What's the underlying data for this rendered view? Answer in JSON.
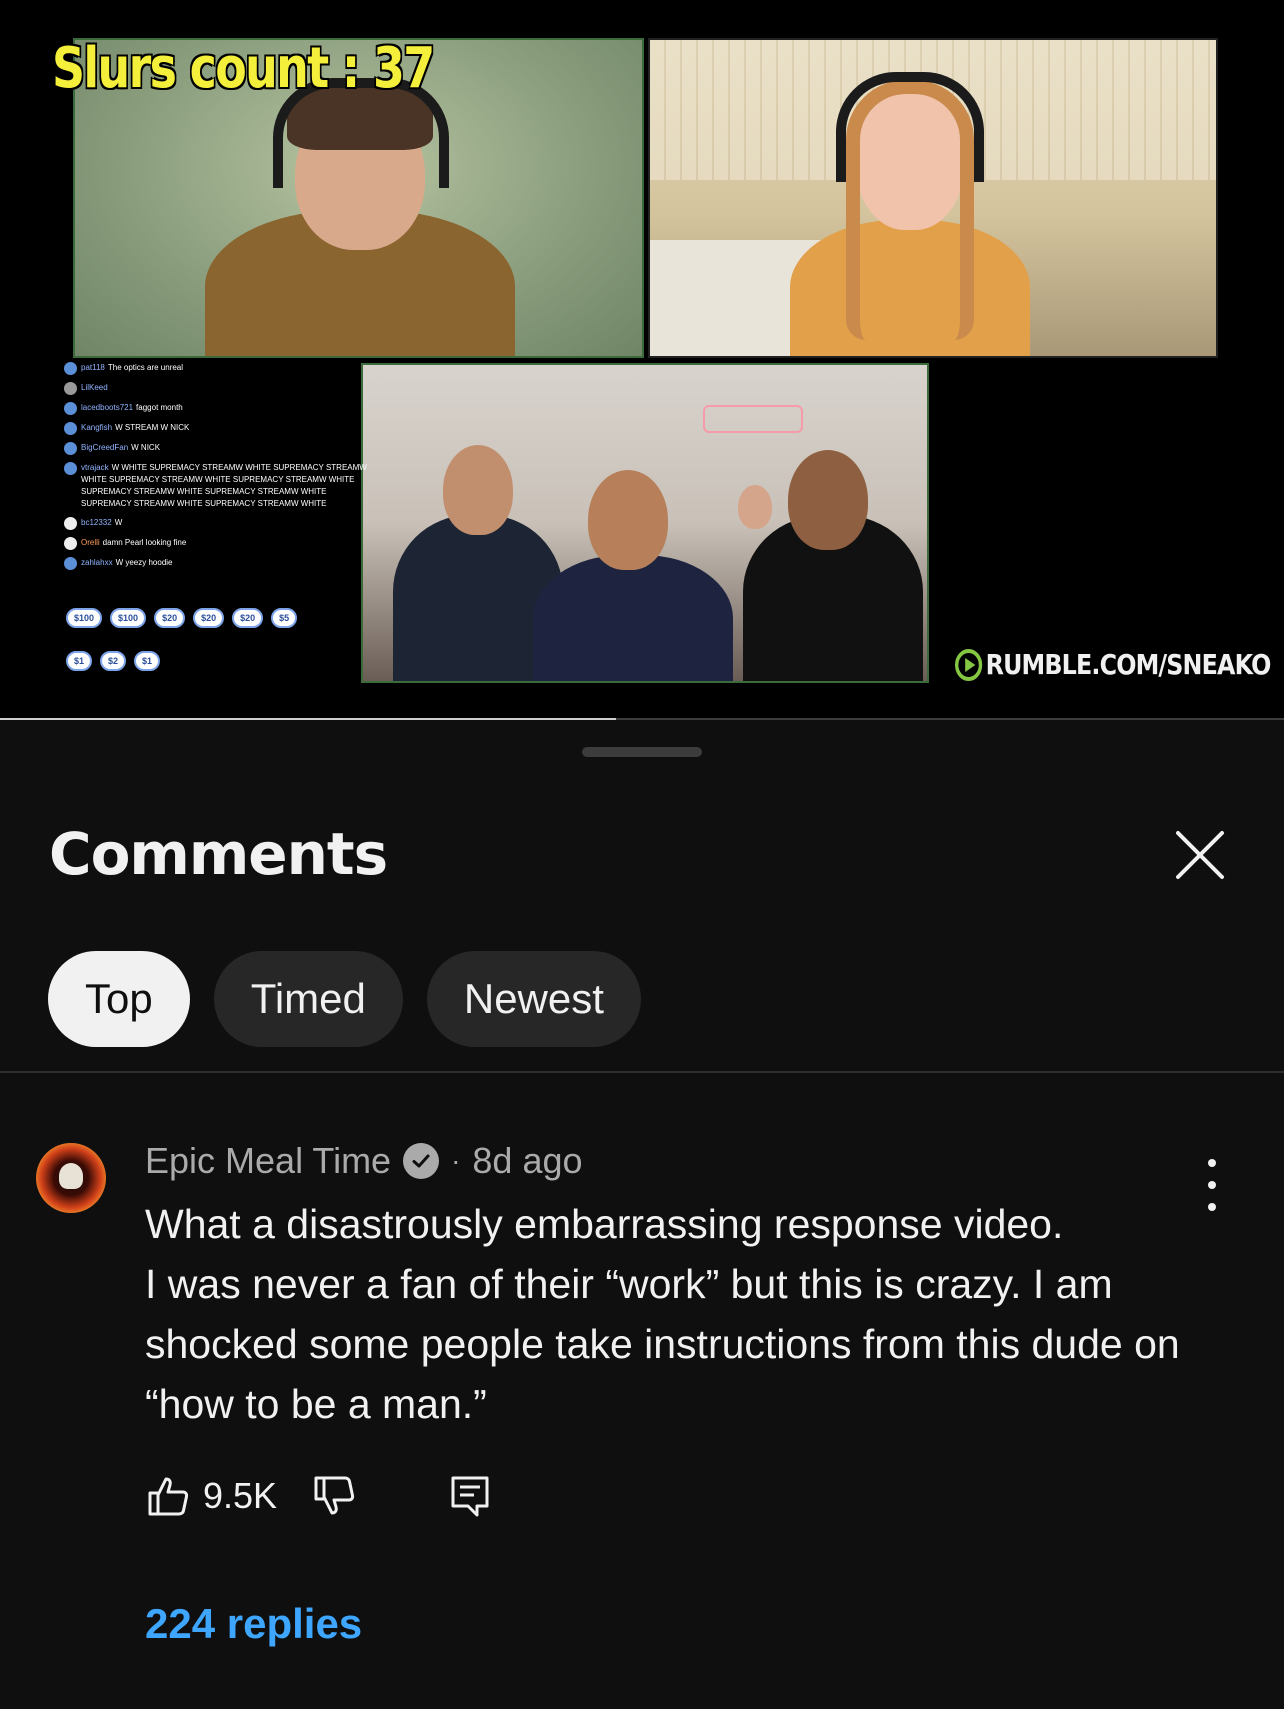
{
  "video": {
    "overlay_title": "Slurs count : 37",
    "watermark": "RUMBLE.COM/SNEAKO",
    "progress_percent": 48,
    "chat": [
      {
        "user": "pat118",
        "text": "The optics are unreal"
      },
      {
        "user": "LilKeed",
        "text": ""
      },
      {
        "user": "lacedboots721",
        "text": "faggot month"
      },
      {
        "user": "Kangfish",
        "text": "W STREAM W NICK"
      },
      {
        "user": "BigCreedFan",
        "text": "W NICK"
      },
      {
        "user": "vtrajack",
        "text": "W WHITE SUPREMACY STREAMW WHITE SUPREMACY STREAMW WHITE SUPREMACY STREAMW WHITE SUPREMACY STREAMW WHITE SUPREMACY STREAMW WHITE SUPREMACY STREAMW WHITE SUPREMACY STREAMW WHITE SUPREMACY STREAMW WHITE"
      },
      {
        "user": "bc12332",
        "text": "W"
      },
      {
        "user": "Orelli",
        "text": "damn Pearl looking fine"
      },
      {
        "user": "zahlahxx",
        "text": "W yeezy hoodie"
      }
    ],
    "donations_row1": [
      "$100",
      "$100",
      "$20",
      "$20",
      "$20",
      "$5"
    ],
    "donations_row2": [
      "$1",
      "$2",
      "$1"
    ]
  },
  "comments": {
    "title": "Comments",
    "chips": [
      "Top",
      "Timed",
      "Newest"
    ],
    "active_chip": "Top",
    "comment": {
      "author": "Epic Meal Time",
      "verified": true,
      "separator": "·",
      "time": "8d ago",
      "text": "What a disastrously embarrassing response video.\nI was never a fan of their “work” but this is crazy. I am shocked some people take instructions from this dude on “how to be a man.”",
      "likes": "9.5K",
      "replies": "224 replies"
    }
  },
  "colors": {
    "background": "#0f0f0f",
    "chip_active_bg": "#f1f1f1",
    "chip_bg": "#272727",
    "link_blue": "#3ea6ff",
    "overlay_yellow": "#f4ef3a",
    "rumble_green": "#85c742"
  },
  "icons": {
    "close": "close-icon",
    "verified": "verified-check-icon",
    "more": "more-vert-icon",
    "like": "thumbs-up-icon",
    "dislike": "thumbs-down-icon",
    "reply": "comment-reply-icon"
  }
}
